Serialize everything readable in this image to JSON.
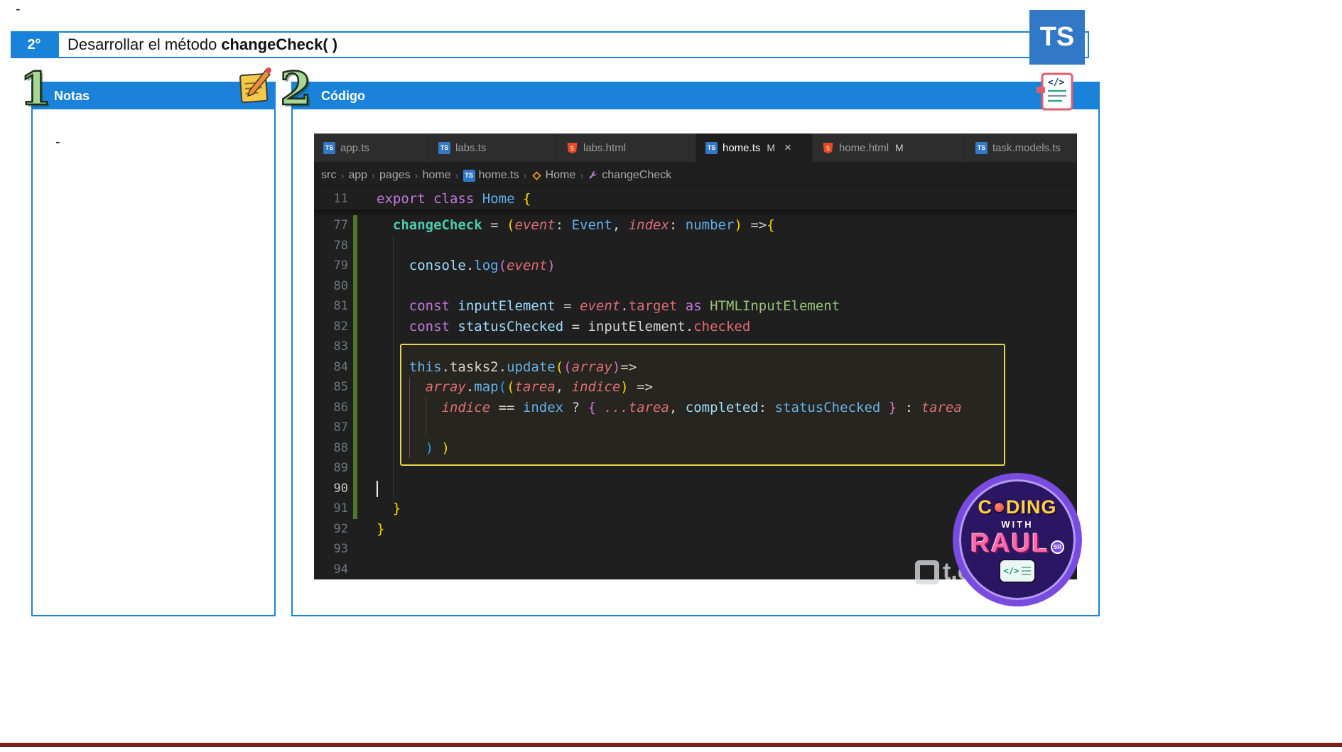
{
  "page": {
    "top_dash": "-"
  },
  "colors": {
    "accent_blue": "#1a82d8",
    "ts_blue": "#3178c6",
    "bottom_bar": "#7a1d1d",
    "editor_bg": "#1f1f1f",
    "git_added": "#4e7a27",
    "annotation_yellow": "#e8d44d"
  },
  "header": {
    "badge": "2°",
    "title_normal": "Desarrollar el método ",
    "title_bold": "changeCheck( )",
    "ts_logo": "TS"
  },
  "notes_panel": {
    "number": "1",
    "title": "Notas",
    "icon": "memo-icon",
    "content_dash": "-"
  },
  "code_panel": {
    "number": "2",
    "title": "Código",
    "icon": "code-document-icon"
  },
  "editor": {
    "ts_icon_label": "TS",
    "html_icon_label": "5",
    "close_glyph": "×",
    "crumb_sep": "›",
    "tabs": [
      {
        "label": "app.ts",
        "icon": "ts"
      },
      {
        "label": "labs.ts",
        "icon": "ts"
      },
      {
        "label": "labs.html",
        "icon": "html"
      },
      {
        "label": "home.ts",
        "icon": "ts",
        "modified": "M",
        "active": true,
        "closable": true
      },
      {
        "label": "home.html",
        "icon": "html",
        "modified": "M"
      },
      {
        "label": "task.models.ts",
        "icon": "ts"
      }
    ],
    "breadcrumbs": [
      {
        "label": "src"
      },
      {
        "label": "app"
      },
      {
        "label": "pages"
      },
      {
        "label": "home"
      },
      {
        "label": "home.ts",
        "icon": "ts"
      },
      {
        "label": "Home",
        "icon": "class"
      },
      {
        "label": "changeCheck",
        "icon": "method"
      }
    ],
    "sticky_line": {
      "num": "11",
      "tokens": [
        [
          "export",
          "pk"
        ],
        [
          " ",
          "w"
        ],
        [
          "class",
          "pk"
        ],
        [
          " ",
          "w"
        ],
        [
          "Home",
          "bl"
        ],
        [
          " ",
          "w"
        ],
        [
          "{",
          "gold"
        ]
      ]
    },
    "lines": [
      {
        "num": 77,
        "git": true,
        "tokens": [
          [
            "  ",
            "w"
          ],
          [
            "changeCheck",
            "decl"
          ],
          [
            " = ",
            "w"
          ],
          [
            "(",
            "gold"
          ],
          [
            "event",
            "pm"
          ],
          [
            ": ",
            "w"
          ],
          [
            "Event",
            "bl"
          ],
          [
            ", ",
            "w"
          ],
          [
            "index",
            "pm"
          ],
          [
            ": ",
            "w"
          ],
          [
            "number",
            "bl"
          ],
          [
            ")",
            "gold"
          ],
          [
            " =>",
            "w"
          ],
          [
            "{",
            "gold"
          ]
        ]
      },
      {
        "num": 78,
        "git": true,
        "tokens": []
      },
      {
        "num": 79,
        "git": true,
        "tokens": [
          [
            "    ",
            "w"
          ],
          [
            "console",
            "lb"
          ],
          [
            ".",
            "w"
          ],
          [
            "log",
            "bl"
          ],
          [
            "(",
            "orc"
          ],
          [
            "event",
            "pm"
          ],
          [
            ")",
            "orc"
          ]
        ]
      },
      {
        "num": 80,
        "git": true,
        "tokens": []
      },
      {
        "num": 81,
        "git": true,
        "tokens": [
          [
            "    ",
            "w"
          ],
          [
            "const",
            "pk"
          ],
          [
            " ",
            "w"
          ],
          [
            "inputElement",
            "lb"
          ],
          [
            " = ",
            "w"
          ],
          [
            "event",
            "pm"
          ],
          [
            ".",
            "w"
          ],
          [
            "target",
            "rd"
          ],
          [
            " ",
            "w"
          ],
          [
            "as",
            "pk"
          ],
          [
            " ",
            "w"
          ],
          [
            "HTMLInputElement",
            "gr"
          ]
        ]
      },
      {
        "num": 82,
        "git": true,
        "tokens": [
          [
            "    ",
            "w"
          ],
          [
            "const",
            "pk"
          ],
          [
            " ",
            "w"
          ],
          [
            "statusChecked",
            "lb"
          ],
          [
            " = ",
            "w"
          ],
          [
            "inputElement",
            "w"
          ],
          [
            ".",
            "w"
          ],
          [
            "checked",
            "rd"
          ]
        ]
      },
      {
        "num": 83,
        "git": true,
        "tokens": []
      },
      {
        "num": 84,
        "git": true,
        "tokens": [
          [
            "    ",
            "w"
          ],
          [
            "this",
            "bl"
          ],
          [
            ".",
            "w"
          ],
          [
            "tasks2",
            "w"
          ],
          [
            ".",
            "w"
          ],
          [
            "update",
            "bl"
          ],
          [
            "(",
            "gold"
          ],
          [
            "(",
            "orc"
          ],
          [
            "array",
            "pm"
          ],
          [
            ")",
            "orc"
          ],
          [
            "=>",
            "w"
          ]
        ]
      },
      {
        "num": 85,
        "git": true,
        "tokens": [
          [
            "      ",
            "w"
          ],
          [
            "array",
            "pm"
          ],
          [
            ".",
            "w"
          ],
          [
            "map",
            "bl"
          ],
          [
            "(",
            "bblue"
          ],
          [
            "(",
            "gold"
          ],
          [
            "tarea",
            "pm"
          ],
          [
            ", ",
            "w"
          ],
          [
            "indice",
            "pm"
          ],
          [
            ")",
            "gold"
          ],
          [
            " =>",
            "w"
          ]
        ]
      },
      {
        "num": 86,
        "git": true,
        "tokens": [
          [
            "        ",
            "w"
          ],
          [
            "indice",
            "pm"
          ],
          [
            " == ",
            "w"
          ],
          [
            "index",
            "bl"
          ],
          [
            " ? ",
            "w"
          ],
          [
            "{",
            "orc"
          ],
          [
            " ",
            "w"
          ],
          [
            "...tarea",
            "pm"
          ],
          [
            ", ",
            "w"
          ],
          [
            "completed",
            "lb"
          ],
          [
            ": ",
            "w"
          ],
          [
            "statusChecked",
            "bl"
          ],
          [
            " ",
            "w"
          ],
          [
            "}",
            "orc"
          ],
          [
            " : ",
            "w"
          ],
          [
            "tarea",
            "pm"
          ]
        ]
      },
      {
        "num": 87,
        "git": true,
        "tokens": []
      },
      {
        "num": 88,
        "git": true,
        "tokens": [
          [
            "      ",
            "w"
          ],
          [
            ")",
            "bblue"
          ],
          [
            " ",
            "w"
          ],
          [
            ")",
            "gold"
          ]
        ]
      },
      {
        "num": 89,
        "git": true,
        "tokens": []
      },
      {
        "num": 90,
        "git": true,
        "active": true,
        "cursor": true,
        "tokens": []
      },
      {
        "num": 91,
        "git": true,
        "tokens": [
          [
            "  ",
            "w"
          ],
          [
            "}",
            "gold"
          ]
        ]
      },
      {
        "num": 92,
        "git": false,
        "tokens": [
          [
            "}",
            "gold"
          ]
        ]
      },
      {
        "num": 93,
        "git": false,
        "tokens": []
      },
      {
        "num": 94,
        "git": false,
        "tokens": []
      }
    ]
  },
  "logo": {
    "coding_pre": "C",
    "coding_post": "DING",
    "with": "WITH",
    "raul": "RAUL",
    "sr": "SR",
    "window_code": "</>"
  },
  "watermark": {
    "text": "t.cz"
  }
}
